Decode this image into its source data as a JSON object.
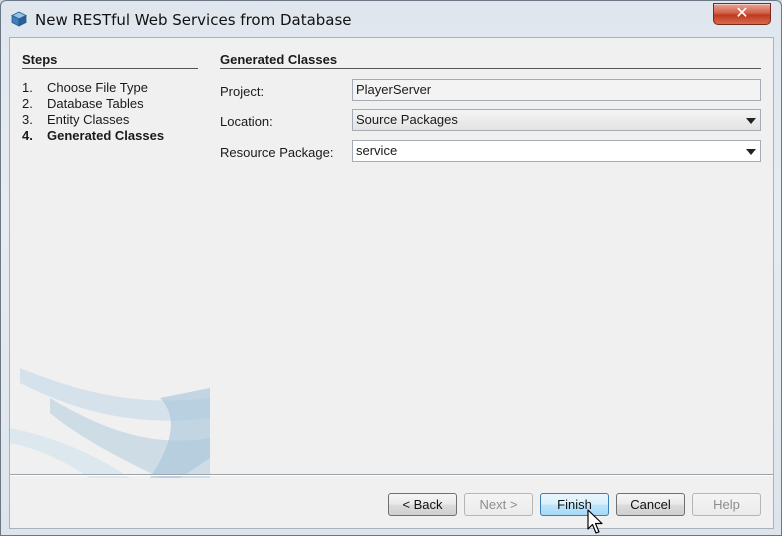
{
  "window": {
    "title": "New RESTful Web Services from Database",
    "close_label": "✕"
  },
  "steps": {
    "title": "Steps",
    "items": [
      {
        "num": "1.",
        "label": "Choose File Type"
      },
      {
        "num": "2.",
        "label": "Database Tables"
      },
      {
        "num": "3.",
        "label": "Entity Classes"
      },
      {
        "num": "4.",
        "label": "Generated Classes"
      }
    ]
  },
  "main": {
    "title": "Generated Classes",
    "project_label": "Project:",
    "project_value": "PlayerServer",
    "location_label": "Location:",
    "location_value": "Source Packages",
    "package_label": "Resource Package:",
    "package_value": "service"
  },
  "buttons": {
    "back": "< Back",
    "next": "Next >",
    "finish": "Finish",
    "cancel": "Cancel",
    "help": "Help"
  },
  "icons": {
    "title_icon": "netbeans-cube-icon",
    "close_icon": "close-icon",
    "combo_arrow": "chevron-down-icon",
    "cursor": "mouse-pointer-icon"
  }
}
